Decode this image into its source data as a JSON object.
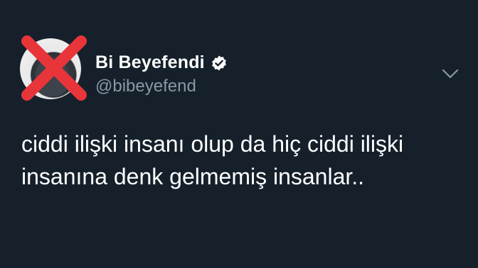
{
  "author": {
    "display_name": "Bi Beyefendi",
    "handle": "@bibeyefend",
    "verified": true,
    "avatar_overlay": "red-x-mark"
  },
  "tweet": {
    "lines": [
      "ciddi ilişki insanı olup da hiç ciddi ilişki",
      "insanına denk gelmemiş insanlar.."
    ]
  },
  "colors": {
    "background": "#15202b",
    "text": "#ffffff",
    "handle": "#8899a6",
    "cross": "#e8353a"
  },
  "icons": {
    "verified": "verified-badge-icon",
    "menu": "chevron-down-icon"
  }
}
